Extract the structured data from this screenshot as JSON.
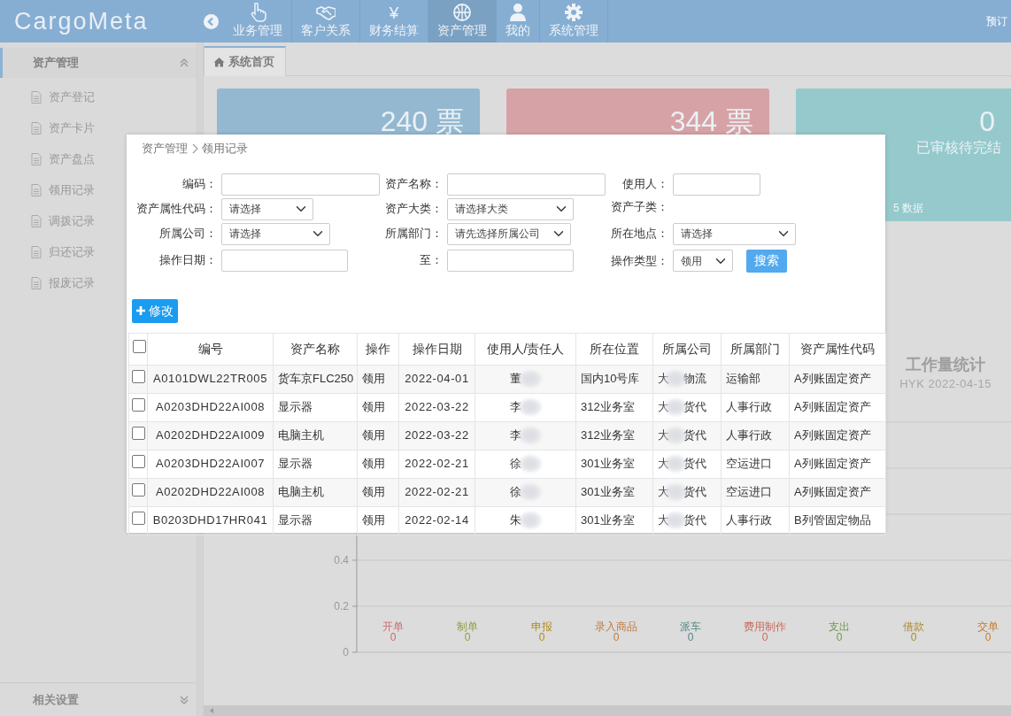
{
  "app": {
    "logo": "CargoMeta",
    "right_link": "预订"
  },
  "nav": [
    {
      "label": "业务管理",
      "selected": false
    },
    {
      "label": "客户关系",
      "selected": false
    },
    {
      "label": "财务结算",
      "glyph": "¥",
      "selected": false
    },
    {
      "label": "资产管理",
      "selected": true
    },
    {
      "label": "我的",
      "selected": false
    },
    {
      "label": "系统管理",
      "selected": false
    }
  ],
  "sidebar": {
    "title": "资产管理",
    "expanded": true,
    "items": [
      "资产登记",
      "资产卡片",
      "资产盘点",
      "领用记录",
      "调拨记录",
      "归还记录",
      "报废记录"
    ],
    "footer": {
      "title": "相关设置",
      "expanded": false
    }
  },
  "tabs": [
    {
      "label": "系统首页",
      "selected": true
    }
  ],
  "stat_cards": [
    {
      "value": "240 票",
      "color": "#93b8d0"
    },
    {
      "value": "344 票",
      "color": "#d7a2a5"
    },
    {
      "value": "0",
      "caption": "已审核待完结",
      "footer": "5 数据",
      "color": "#95c9cc"
    }
  ],
  "workload": {
    "title": "工作量统计",
    "subtitle": "HYK 2022-04-15",
    "chart_data": {
      "type": "bar",
      "categories": [
        "开单",
        "制单",
        "申报",
        "录入商品",
        "派车",
        "费用制作",
        "支出",
        "借款",
        "交单"
      ],
      "values": [
        0,
        0,
        0,
        0,
        0,
        0,
        0,
        0,
        0
      ],
      "colors": [
        "#d06a6a",
        "#8f9c3c",
        "#b08a1c",
        "#c27838",
        "#4f8683",
        "#c96a5c",
        "#6f9a48",
        "#a88a30",
        "#c27a30"
      ],
      "ylim": [
        0,
        1
      ],
      "yticks": [
        0,
        0.2,
        0.4
      ],
      "data_labels": true
    }
  },
  "dialog": {
    "breadcrumb": [
      "资产管理",
      "领用记录"
    ],
    "filters": [
      [
        {
          "label": "编码：",
          "kind": "text"
        },
        {
          "label": "资产名称：",
          "kind": "text"
        },
        {
          "label": "使用人：",
          "kind": "text"
        }
      ],
      [
        {
          "label": "资产属性代码：",
          "kind": "select",
          "value": "请选择"
        },
        {
          "label": "资产大类：",
          "kind": "select",
          "value": "请选择大类"
        },
        {
          "label": "资产子类：",
          "kind": "empty"
        }
      ],
      [
        {
          "label": "所属公司：",
          "kind": "select",
          "value": "请选择"
        },
        {
          "label": "所属部门：",
          "kind": "select",
          "value": "请先选择所属公司"
        },
        {
          "label": "所在地点：",
          "kind": "select",
          "value": "请选择"
        }
      ],
      [
        {
          "label": "操作日期：",
          "kind": "text"
        },
        {
          "label": "至：",
          "kind": "text"
        },
        {
          "label": "操作类型：",
          "kind": "select",
          "value": "领用"
        }
      ]
    ],
    "search_button": "搜索",
    "edit_button": "修改",
    "table": {
      "all_selected": false,
      "columns": [
        "编号",
        "资产名称",
        "操作",
        "操作日期",
        "使用人/责任人",
        "所在位置",
        "所属公司",
        "所属部门",
        "资产属性代码"
      ],
      "rows": [
        {
          "selected": false,
          "code": "A0101DWL22TR005",
          "name": "货车京FLC250",
          "op": "领用",
          "date": "2022-04-01",
          "user": "董",
          "location": "国内10号库",
          "company": [
            "大",
            "物流"
          ],
          "dept": "运输部",
          "attr": "A列账固定资产"
        },
        {
          "selected": false,
          "code": "A0203DHD22AI008",
          "name": "显示器",
          "op": "领用",
          "date": "2022-03-22",
          "user": "李",
          "location": "312业务室",
          "company": [
            "大",
            "货代"
          ],
          "dept": "人事行政",
          "attr": "A列账固定资产"
        },
        {
          "selected": false,
          "code": "A0202DHD22AI009",
          "name": "电脑主机",
          "op": "领用",
          "date": "2022-03-22",
          "user": "李",
          "location": "312业务室",
          "company": [
            "大",
            "货代"
          ],
          "dept": "人事行政",
          "attr": "A列账固定资产"
        },
        {
          "selected": false,
          "code": "A0203DHD22AI007",
          "name": "显示器",
          "op": "领用",
          "date": "2022-02-21",
          "user": "徐",
          "location": "301业务室",
          "company": [
            "大",
            "货代"
          ],
          "dept": "空运进口",
          "attr": "A列账固定资产"
        },
        {
          "selected": false,
          "code": "A0202DHD22AI008",
          "name": "电脑主机",
          "op": "领用",
          "date": "2022-02-21",
          "user": "徐",
          "location": "301业务室",
          "company": [
            "大",
            "货代"
          ],
          "dept": "空运进口",
          "attr": "A列账固定资产"
        },
        {
          "selected": false,
          "code": "B0203DHD17HR041",
          "name": "显示器",
          "op": "领用",
          "date": "2022-02-14",
          "user": "朱",
          "location": "301业务室",
          "company": [
            "大",
            "货代"
          ],
          "dept": "人事行政",
          "attr": "B列管固定物品"
        }
      ]
    }
  }
}
